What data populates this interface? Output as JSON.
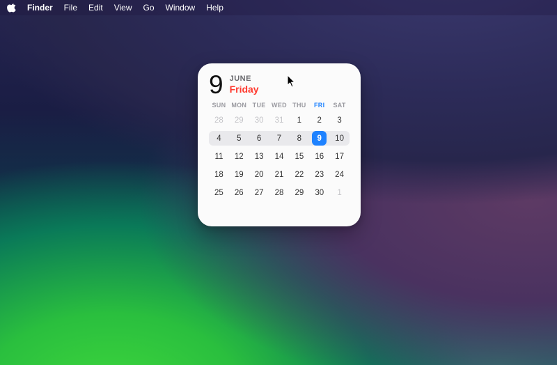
{
  "menu": {
    "app_name": "Finder",
    "items": [
      "File",
      "Edit",
      "View",
      "Go",
      "Window",
      "Help"
    ]
  },
  "calendar": {
    "big_day": "9",
    "month": "JUNE",
    "day_name": "Friday",
    "today_color": "#ff3b30",
    "today_bg": "#1e82ff",
    "day_headers": [
      "SUN",
      "MON",
      "TUE",
      "WED",
      "THU",
      "FRI",
      "SAT"
    ],
    "today_column_index": 5,
    "weeks": [
      {
        "current": false,
        "days": [
          {
            "n": "28",
            "other": true
          },
          {
            "n": "29",
            "other": true
          },
          {
            "n": "30",
            "other": true
          },
          {
            "n": "31",
            "other": true
          },
          {
            "n": "1",
            "other": false
          },
          {
            "n": "2",
            "other": false
          },
          {
            "n": "3",
            "other": false
          }
        ]
      },
      {
        "current": true,
        "days": [
          {
            "n": "4",
            "other": false
          },
          {
            "n": "5",
            "other": false
          },
          {
            "n": "6",
            "other": false
          },
          {
            "n": "7",
            "other": false
          },
          {
            "n": "8",
            "other": false
          },
          {
            "n": "9",
            "other": false,
            "today": true
          },
          {
            "n": "10",
            "other": false
          }
        ]
      },
      {
        "current": false,
        "days": [
          {
            "n": "11",
            "other": false
          },
          {
            "n": "12",
            "other": false
          },
          {
            "n": "13",
            "other": false
          },
          {
            "n": "14",
            "other": false
          },
          {
            "n": "15",
            "other": false
          },
          {
            "n": "16",
            "other": false
          },
          {
            "n": "17",
            "other": false
          }
        ]
      },
      {
        "current": false,
        "days": [
          {
            "n": "18",
            "other": false
          },
          {
            "n": "19",
            "other": false
          },
          {
            "n": "20",
            "other": false
          },
          {
            "n": "21",
            "other": false
          },
          {
            "n": "22",
            "other": false
          },
          {
            "n": "23",
            "other": false
          },
          {
            "n": "24",
            "other": false
          }
        ]
      },
      {
        "current": false,
        "days": [
          {
            "n": "25",
            "other": false
          },
          {
            "n": "26",
            "other": false
          },
          {
            "n": "27",
            "other": false
          },
          {
            "n": "28",
            "other": false
          },
          {
            "n": "29",
            "other": false
          },
          {
            "n": "30",
            "other": false
          },
          {
            "n": "1",
            "other": true
          }
        ]
      }
    ]
  }
}
